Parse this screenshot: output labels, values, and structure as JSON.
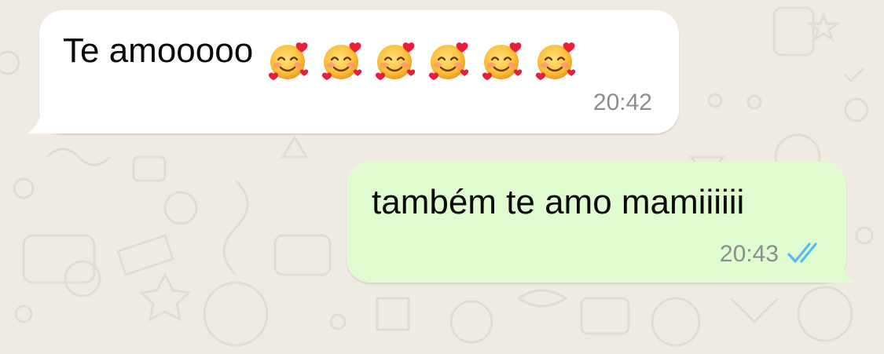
{
  "conversation": {
    "messages": [
      {
        "direction": "incoming",
        "text": "Te amooooo",
        "emoji": "smiling-face-with-hearts",
        "emoji_count": 6,
        "time": "20:42"
      },
      {
        "direction": "outgoing",
        "text": "também te amo mamiiiiii",
        "time": "20:43",
        "status": "read",
        "status_icon": "double-check-icon"
      }
    ]
  },
  "colors": {
    "background": "#efeae2",
    "incoming_bubble": "#ffffff",
    "outgoing_bubble": "#e1fbd1",
    "timestamp": "#8d8d8d",
    "read_ticks": "#53bdeb"
  }
}
